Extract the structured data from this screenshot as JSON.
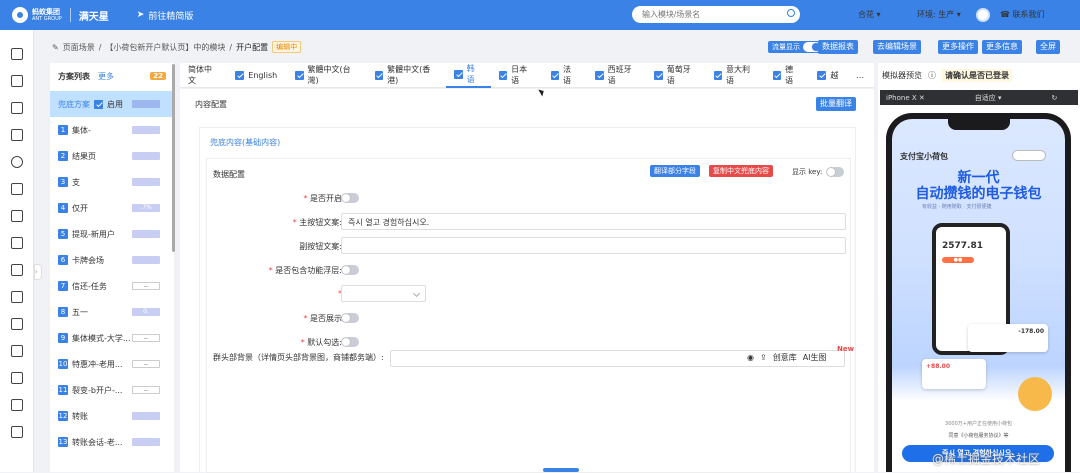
{
  "header": {
    "logo_text": "蚂蚁集团",
    "logo_sub": "ANT GROUP",
    "product": "满天星",
    "goto": "前往精简版",
    "search_placeholder": "输入模块/场景名",
    "user": "合花",
    "env": "环境: 生产",
    "contact": "联系我们"
  },
  "breadcrumb": {
    "item1": "页面场景",
    "item2": "【小荷包新开户默认页】中的模块",
    "item3": "开户配置",
    "tag": "编辑中"
  },
  "toolbar": {
    "flow_label": "流量显示",
    "buttons": [
      "数据报表",
      "去编辑场景",
      "更多操作",
      "更多信息",
      "全屏"
    ]
  },
  "plans": {
    "title": "方案列表",
    "more": "更多",
    "count": "22",
    "fallback": "兜底方案",
    "enabled": "启用",
    "rows": [
      {
        "idx": "1",
        "name": "集体-",
        "pill": ""
      },
      {
        "idx": "2",
        "name": "结果页",
        "pill": ""
      },
      {
        "idx": "3",
        "name": "支",
        "pill": ""
      },
      {
        "idx": "4",
        "name": "仅开",
        "pill": ".7%"
      },
      {
        "idx": "5",
        "name": "提现-新用户",
        "pill": ""
      },
      {
        "idx": "6",
        "name": "卡牌会场",
        "pill": ""
      },
      {
        "idx": "7",
        "name": "信还-任务",
        "pill": "--"
      },
      {
        "idx": "8",
        "name": "五一",
        "pill": "0."
      },
      {
        "idx": "9",
        "name": "集体模式-大学...",
        "pill": "--"
      },
      {
        "idx": "10",
        "name": "特惠冲-老用...",
        "pill": "--"
      },
      {
        "idx": "11",
        "name": "裂变-b开户-...",
        "pill": "--"
      },
      {
        "idx": "12",
        "name": "转账",
        "pill": ""
      },
      {
        "idx": "13",
        "name": "转账会话-老...",
        "pill": ""
      }
    ]
  },
  "languages": [
    {
      "label": "简体中文",
      "checkbox": false
    },
    {
      "label": "English",
      "checkbox": true
    },
    {
      "label": "繁體中文(台灣)",
      "checkbox": true
    },
    {
      "label": "繁體中文(香港)",
      "checkbox": true
    },
    {
      "label": "韩语",
      "checkbox": true,
      "active": true
    },
    {
      "label": "日本语",
      "checkbox": true
    },
    {
      "label": "法语",
      "checkbox": true
    },
    {
      "label": "西班牙语",
      "checkbox": true
    },
    {
      "label": "葡萄牙语",
      "checkbox": true
    },
    {
      "label": "意大利语",
      "checkbox": true
    },
    {
      "label": "德语",
      "checkbox": true
    },
    {
      "label": "越",
      "checkbox": true
    },
    {
      "label": "...",
      "checkbox": false
    }
  ],
  "content": {
    "title": "内容配置",
    "batch": "批量翻译",
    "tab": "兜底内容(基础内容)",
    "data_title": "数据配置",
    "translate_part": "翻译部分字段",
    "copy_cn": "复制中文兜底内容",
    "show_key": "显示 key:",
    "fields": [
      {
        "label": "是否开启",
        "req": true,
        "kind": "toggle",
        "value": ""
      },
      {
        "label": "主按钮文案:",
        "req": true,
        "kind": "input",
        "value": "즉시 열고 경험하십시오."
      },
      {
        "label": "副按钮文案:",
        "req": false,
        "kind": "input",
        "value": ""
      },
      {
        "label": "是否包含功能浮层:",
        "req": true,
        "kind": "toggle",
        "value": ""
      },
      {
        "label": "",
        "req": true,
        "kind": "select",
        "value": ""
      },
      {
        "label": "是否展示",
        "req": true,
        "kind": "toggle",
        "value": ""
      },
      {
        "label": "默认勾选:",
        "req": true,
        "kind": "toggle",
        "value": ""
      }
    ],
    "bg_label": "群头部背景（详情页头部背景图，商铺都务端）:",
    "bg_tools": [
      "创意库",
      "AI生图"
    ],
    "new_badge": "New"
  },
  "simulator": {
    "label": "模拟器预览",
    "warn": "请确认是否已登录",
    "device": "iPhone X",
    "fit": "自适应",
    "app_title": "支付宝小荷包",
    "headline1": "新一代",
    "headline2": "自动攒钱的电子钱包",
    "sub": "有收益 · 随用随取 · 支付很便捷",
    "amount": "2577.81",
    "card_neg": "-178.00",
    "card_pos": "+88.00",
    "fine_print": "3000万+用户正在使用小荷包",
    "agree": "同意《小荷包服务协议》等",
    "cta": "즉시 열고 경험하십시오."
  },
  "watermark": "@稀土掘金技术社区"
}
